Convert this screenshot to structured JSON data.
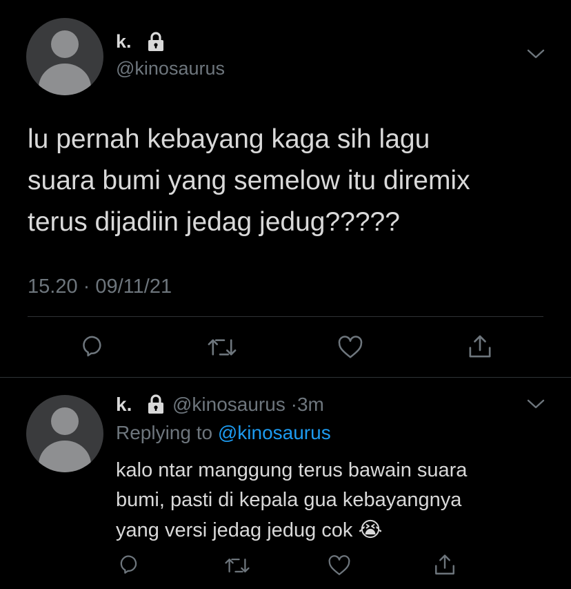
{
  "main_tweet": {
    "display_name": "k.",
    "handle": "@kinosaurus",
    "text_lines": [
      "lu pernah kebayang kaga sih lagu",
      "suara bumi yang semelow itu diremix",
      "terus dijadiin jedag jedug?????"
    ],
    "timestamp": "15.20 · 09/11/21",
    "icons": [
      "reply-icon",
      "retweet-icon",
      "like-icon",
      "share-icon"
    ]
  },
  "reply_tweet": {
    "display_name": "k.",
    "handle": "@kinosaurus",
    "dot": "·",
    "time_ago": "3m",
    "replying_prefix": "Replying to",
    "replying_handle": "@kinosaurus",
    "text_lines": [
      "kalo ntar manggung terus bawain suara",
      "bumi, pasti di kepala gua kebayangnya",
      "yang versi jedag jedug cok"
    ],
    "emoji": "😭",
    "icons": [
      "reply-icon",
      "retweet-icon",
      "like-icon",
      "share-icon"
    ]
  },
  "colors": {
    "background": "#000000",
    "text": "#d9d9d9",
    "muted": "#6e767d",
    "link": "#1d9bf0",
    "divider": "#2f3336"
  }
}
